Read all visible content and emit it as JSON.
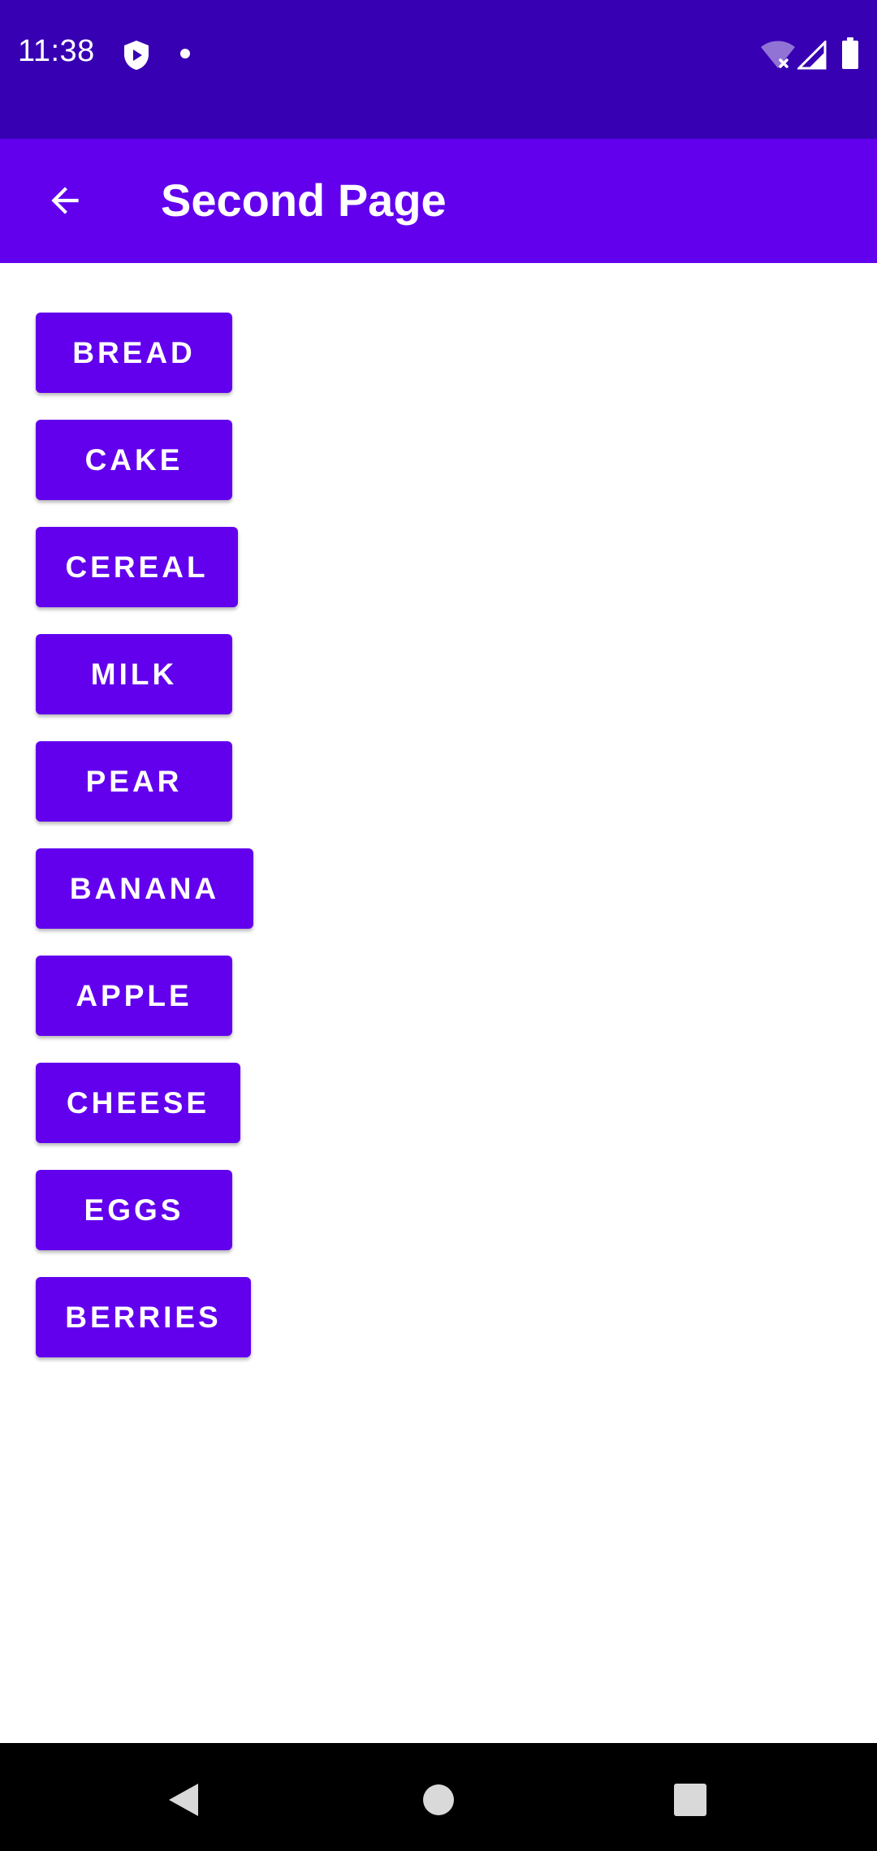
{
  "status_bar": {
    "time": "11:38",
    "icons": [
      "shield-icon",
      "notification-dot-icon",
      "wifi-off-icon",
      "cell-signal-icon",
      "battery-icon"
    ]
  },
  "app_bar": {
    "title": "Second Page",
    "back_icon": "arrow-left-icon"
  },
  "buttons": [
    {
      "label": "BREAD"
    },
    {
      "label": "CAKE"
    },
    {
      "label": "CEREAL"
    },
    {
      "label": "MILK"
    },
    {
      "label": "PEAR"
    },
    {
      "label": "BANANA"
    },
    {
      "label": "APPLE"
    },
    {
      "label": "CHEESE"
    },
    {
      "label": "EGGS"
    },
    {
      "label": "BERRIES"
    }
  ],
  "nav_bar": {
    "icons": [
      "back-triangle-icon",
      "home-circle-icon",
      "recents-square-icon"
    ]
  },
  "colors": {
    "status_bar": "#3700b3",
    "primary": "#6200ee",
    "on_primary": "#ffffff",
    "nav_bar": "#000000",
    "background": "#ffffff"
  }
}
